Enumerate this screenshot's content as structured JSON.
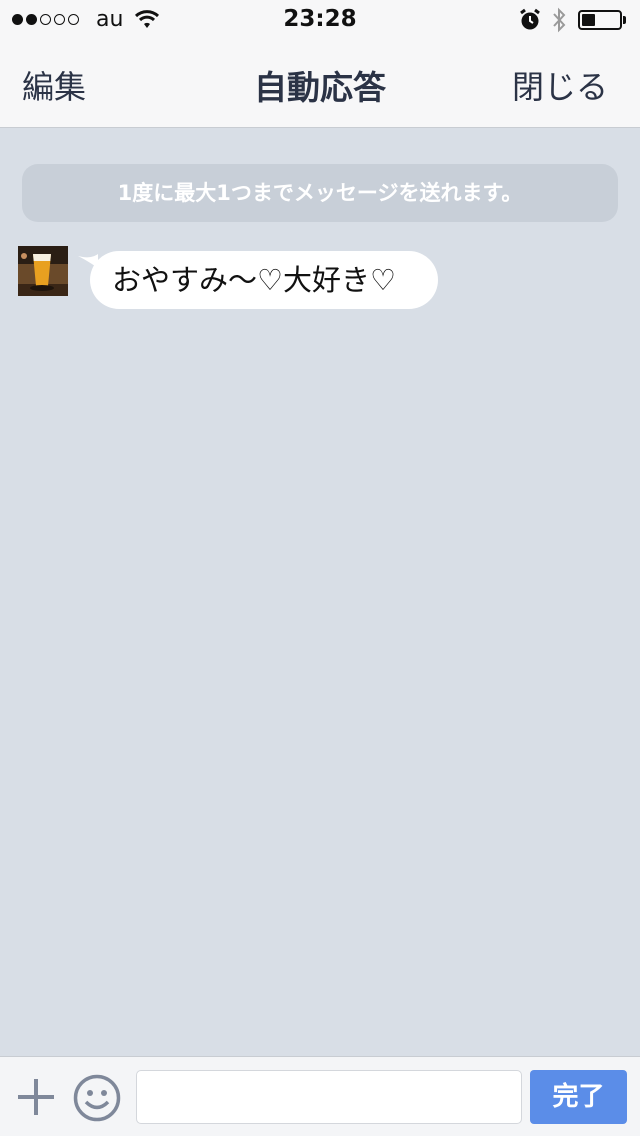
{
  "status_bar": {
    "carrier": "au",
    "time": "23:28",
    "signal_bars_filled": 2,
    "signal_bars_total": 5,
    "battery_level": 0.35,
    "icons": [
      "wifi-icon",
      "alarm-icon",
      "bluetooth-icon",
      "battery-icon"
    ]
  },
  "nav": {
    "left_label": "編集",
    "title": "自動応答",
    "right_label": "閉じる"
  },
  "chat": {
    "notice": "1度に最大1つまでメッセージを送れます。",
    "messages": [
      {
        "text": "おやすみ〜♡大好き♡",
        "avatar": "beer-glass-photo"
      }
    ]
  },
  "input_bar": {
    "value": "",
    "placeholder": "",
    "done_label": "完了",
    "icons": [
      "plus-icon",
      "emoji-icon"
    ]
  },
  "colors": {
    "background": "#d8dee6",
    "bar": "#f7f7f8",
    "accent": "#5b8de8",
    "notice_bg": "#c8cfd8",
    "text_dark": "#2b3346"
  }
}
